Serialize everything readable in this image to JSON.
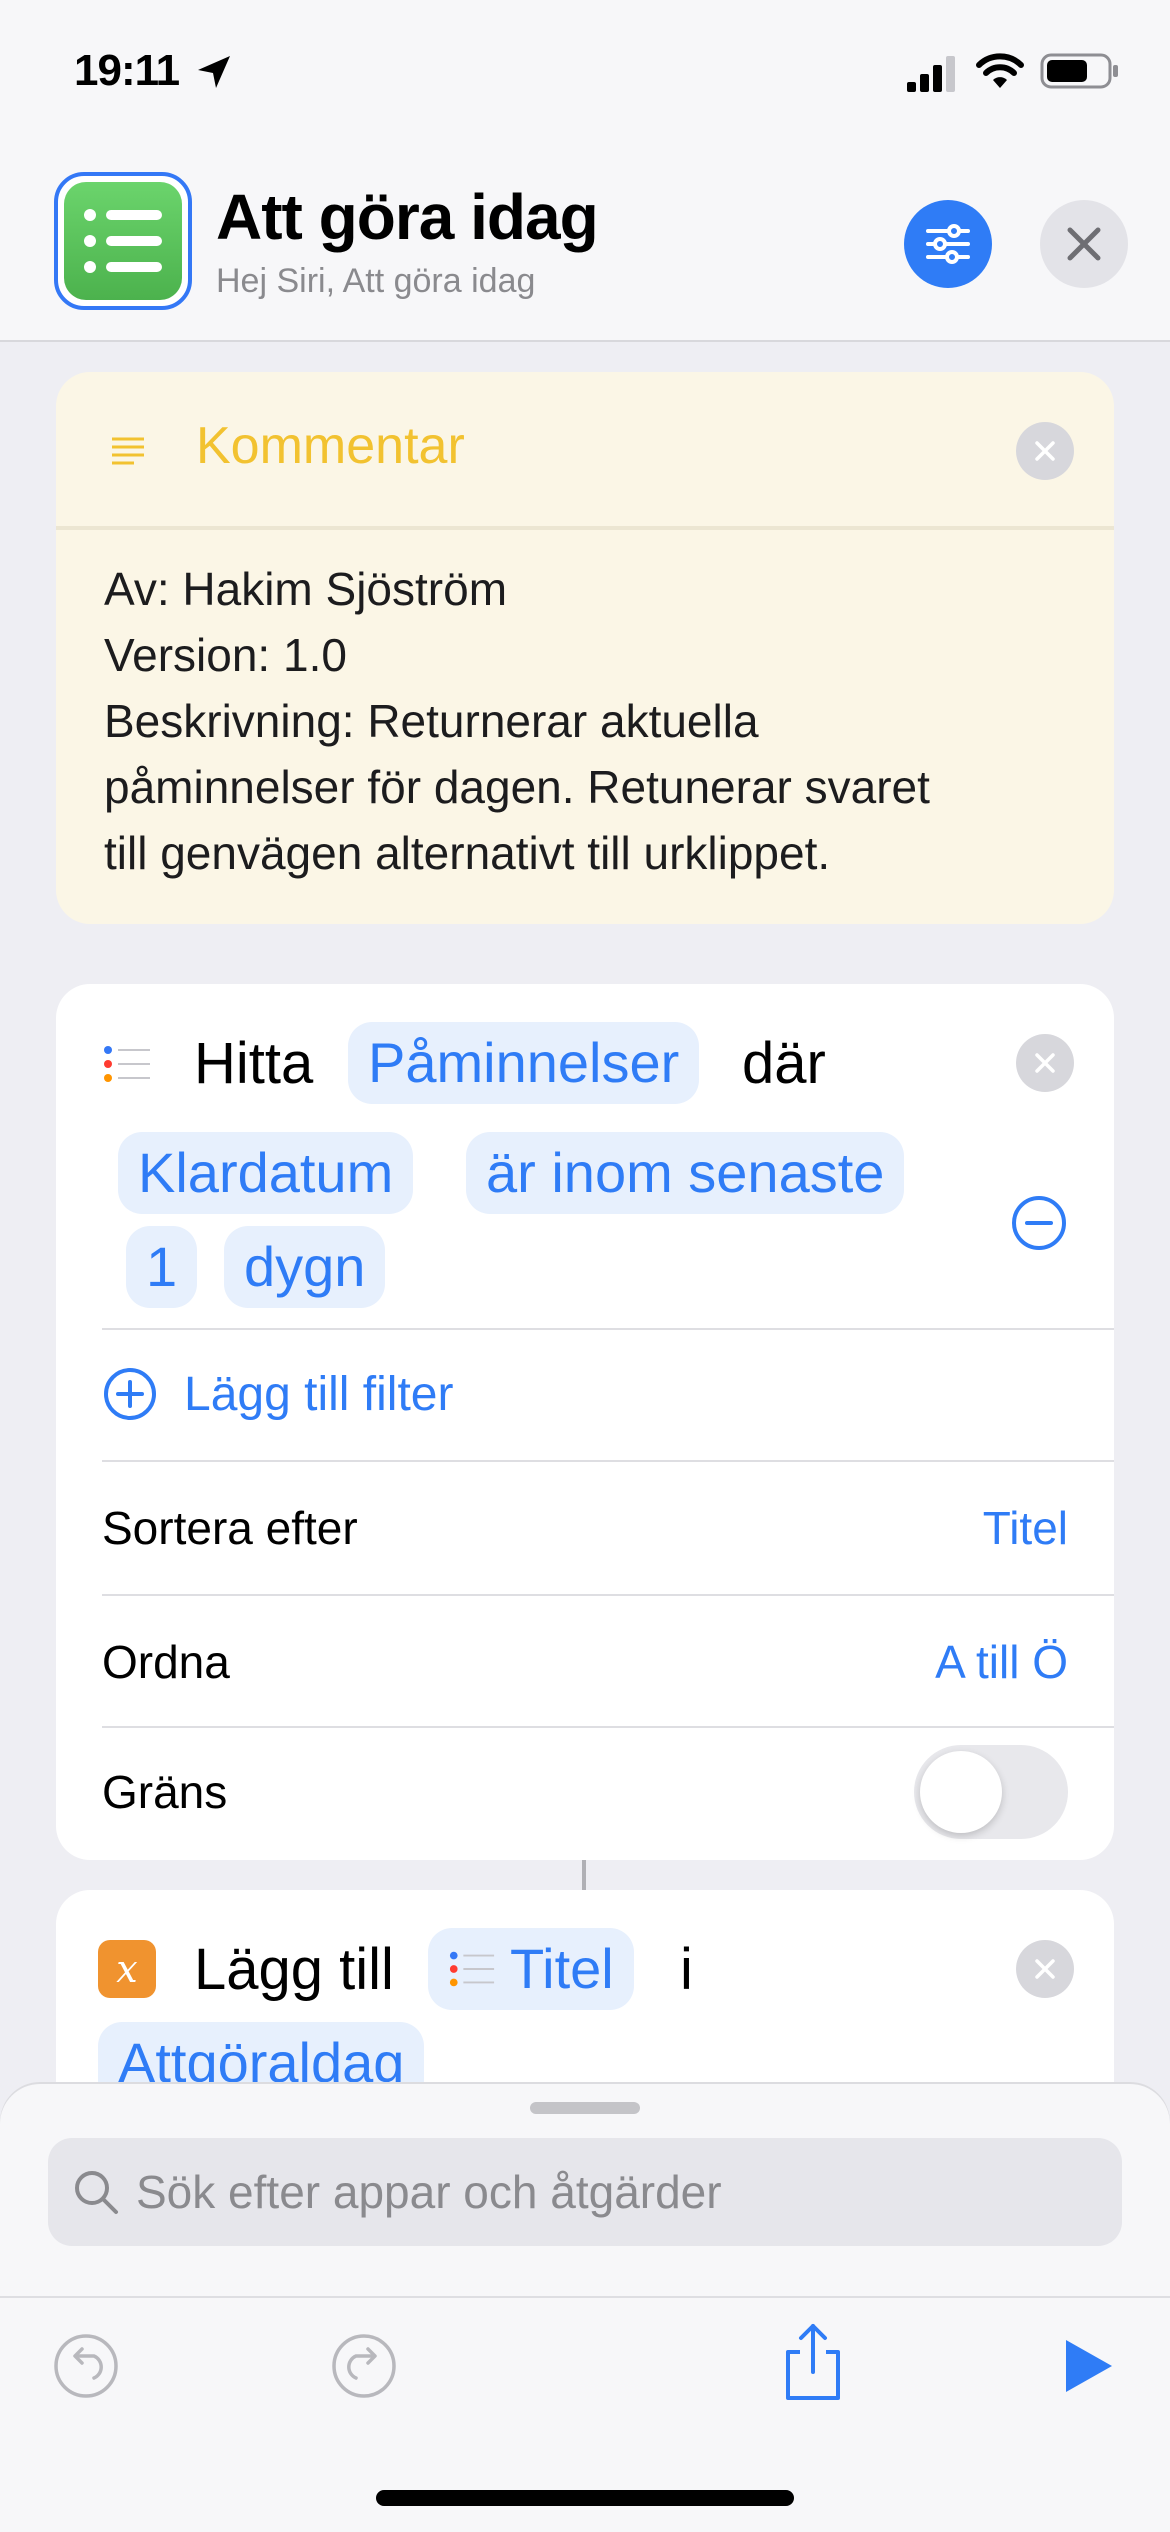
{
  "status_bar": {
    "time": "19:11",
    "icons": [
      "location-arrow-icon",
      "cellular-signal-icon",
      "wifi-icon",
      "battery-icon"
    ]
  },
  "header": {
    "title": "Att göra idag",
    "subtitle": "Hej Siri, Att göra idag",
    "app_icon": "list-icon",
    "accent_color": "#2f7cf6",
    "app_icon_color": "#5bc35c"
  },
  "comment": {
    "title": "Kommentar",
    "lines": [
      "Av: Hakim Sjöström",
      "Version: 1.0",
      "Beskrivning: Returnerar aktuella",
      "påminnelser för dagen. Retunerar svaret",
      "till genvägen alternativt till urklippet."
    ],
    "title_color": "#f2c230"
  },
  "find_action": {
    "verb": "Hitta",
    "entity": "Påminnelser",
    "where": "där",
    "filter": {
      "field": "Klardatum",
      "operator": "är inom senaste",
      "amount": "1",
      "unit": "dygn"
    },
    "add_filter_label": "Lägg till filter",
    "sort_label": "Sortera efter",
    "sort_value": "Titel",
    "order_label": "Ordna",
    "order_value": "A till Ö",
    "limit_label": "Gräns",
    "limit_enabled": false
  },
  "add_action": {
    "verb": "Lägg till",
    "item": "Titel",
    "preposition": "i",
    "target": "Attgöraldag"
  },
  "search": {
    "placeholder": "Sök efter appar och åtgärder"
  },
  "toolbar": {
    "buttons": [
      "undo-icon",
      "redo-icon",
      "share-icon",
      "play-icon"
    ]
  }
}
